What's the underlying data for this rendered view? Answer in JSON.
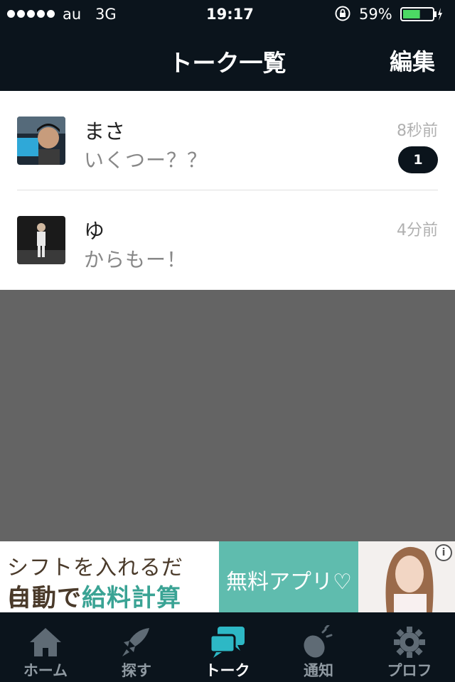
{
  "status_bar": {
    "carrier": "au",
    "network": "3G",
    "time": "19:17",
    "battery_percent": "59%",
    "battery_level": 0.59
  },
  "nav": {
    "title": "トーク一覧",
    "edit_label": "編集"
  },
  "chats": [
    {
      "name": "まさ",
      "last_message": "いくつー？？",
      "time": "8秒前",
      "unread": "1"
    },
    {
      "name": "ゆ",
      "last_message": "からもー！",
      "time": "4分前",
      "unread": ""
    }
  ],
  "ad": {
    "line1": "シフトを入れるだけ！",
    "line2_a": "自動で",
    "line2_b": "給料計算",
    "middle": "無料アプリ♡",
    "info": "i"
  },
  "tabs": [
    {
      "label": "ホーム",
      "icon": "home-icon"
    },
    {
      "label": "探す",
      "icon": "rocket-icon"
    },
    {
      "label": "トーク",
      "icon": "chat-bubbles-icon",
      "active": true
    },
    {
      "label": "通知",
      "icon": "megaphone-icon"
    },
    {
      "label": "プロフ",
      "icon": "gear-icon"
    }
  ],
  "colors": {
    "bar_bg": "#0b141c",
    "accent": "#2db8c5",
    "battery": "#4cd964",
    "ad_green": "#5fbcae"
  }
}
